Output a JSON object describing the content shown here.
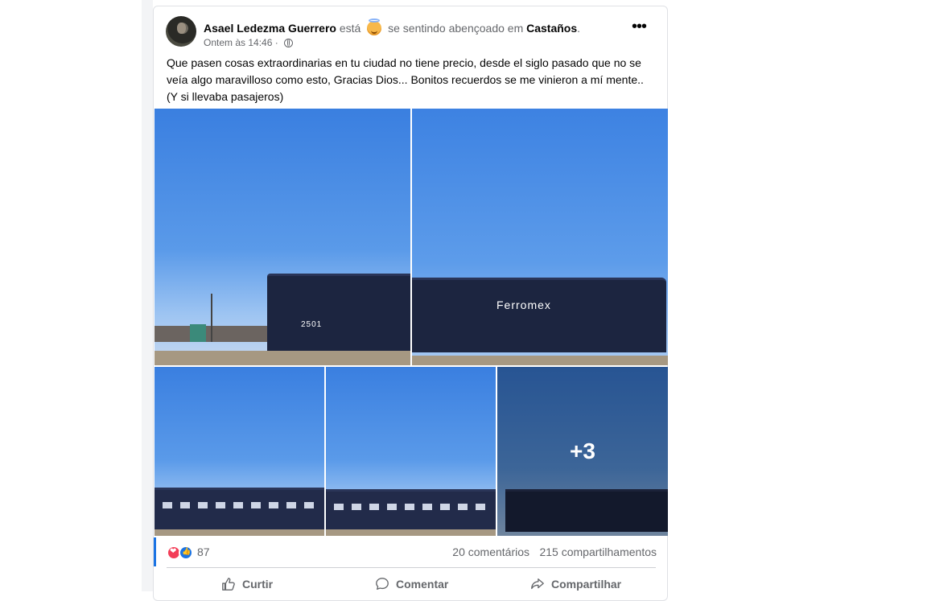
{
  "post": {
    "author": "Asael Ledezma Guerrero",
    "esta": "está",
    "feeling": "se sentindo abençoado em",
    "location": "Castaños",
    "period": ".",
    "time": "Ontem às 14:46",
    "dot": "·",
    "text": "Que pasen cosas extraordinarias en tu ciudad no tiene precio, desde el siglo pasado que no se veía algo maravilloso como esto, Gracias Dios... Bonitos recuerdos se me vinieron a mí mente.. (Y si llevaba pasajeros)",
    "icons": {
      "more": "more-options-icon",
      "privacy": "globe-icon",
      "feeling": "angel-emoji-icon"
    }
  },
  "photos": {
    "loco_number": "2501",
    "loco_brand": "Ferromex",
    "more_count": "+3"
  },
  "stats": {
    "reactions": "87",
    "comments": "20 comentários",
    "shares": "215 compartilhamentos",
    "reaction_icons": [
      "love-reaction-icon",
      "like-reaction-icon"
    ]
  },
  "actions": {
    "like": "Curtir",
    "comment": "Comentar",
    "share": "Compartilhar"
  },
  "colors": {
    "accent": "#1b74e4",
    "muted": "#65676b",
    "love": "#f33e58"
  }
}
